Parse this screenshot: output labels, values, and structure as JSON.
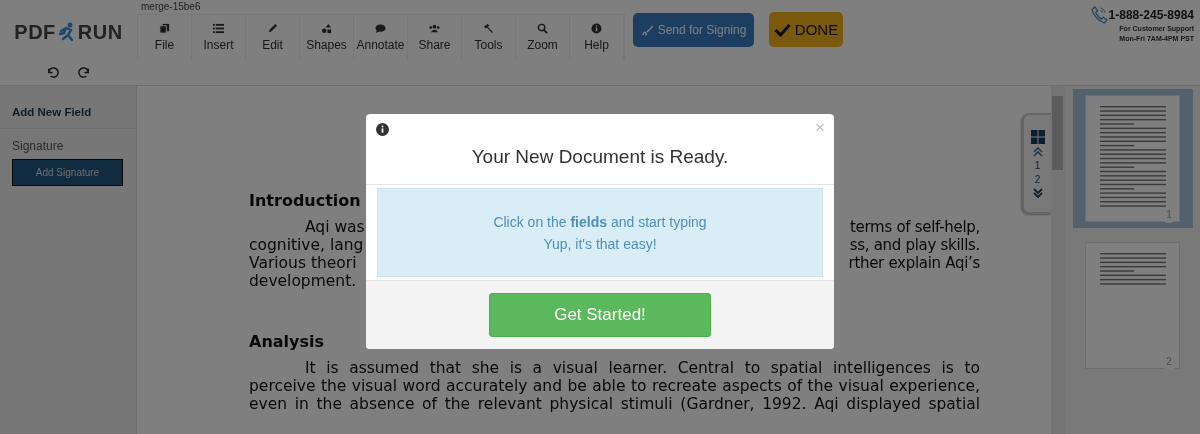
{
  "logo": {
    "left": "PDF",
    "right": "RUN"
  },
  "file_name": "merge-15be6",
  "menu": [
    {
      "kind": "file",
      "label": "File"
    },
    {
      "kind": "insert",
      "label": "Insert"
    },
    {
      "kind": "edit",
      "label": "Edit"
    },
    {
      "kind": "shapes",
      "label": "Shapes"
    },
    {
      "kind": "annotate",
      "label": "Annotate"
    },
    {
      "kind": "share",
      "label": "Share"
    },
    {
      "kind": "tools",
      "label": "Tools"
    },
    {
      "kind": "zoom",
      "label": "Zoom"
    },
    {
      "kind": "help",
      "label": "Help"
    }
  ],
  "send_button": "Send for Signing",
  "done_button": "DONE",
  "support": {
    "phone": "1-888-245-8984",
    "line1": "For Customer Support",
    "line2": "Mon-Fri 7AM-4PM PST"
  },
  "sidebar": {
    "title": "Add New Field",
    "section": "Signature",
    "button": "Add Signature"
  },
  "document": {
    "sections": [
      {
        "heading": "Introduction",
        "lines": [
          {
            "left": "Aqi was",
            "right": "terms of self-help,",
            "indent": true
          },
          {
            "left": "cognitive, lang",
            "right": "ss, and play skills.",
            "indent": false
          },
          {
            "left": "Various theori",
            "right": "rther explain Aqi’s",
            "indent": false
          },
          {
            "left": "development.",
            "indent": false
          }
        ]
      },
      {
        "heading": "Analysis",
        "lines": [
          {
            "left": "It is assumed that she is a visual learner.  Central to spatial intelligences is to",
            "indent": true
          },
          {
            "left": "perceive the visual word accurately and be able to recreate aspects of the visual experience,",
            "indent": false
          },
          {
            "left": "even in the absence of the relevant physical stimuli (Gardner, 1992. Aqi displayed spatial",
            "indent": false
          }
        ]
      }
    ]
  },
  "page_nav": {
    "pages": [
      "1",
      "2"
    ]
  },
  "thumbnails": [
    {
      "label": "1",
      "selected": true
    },
    {
      "label": "2",
      "selected": false
    }
  ],
  "modal": {
    "title": "Your New Document is Ready.",
    "close": "×",
    "message": "Click on the **fields** and start typing",
    "message2": "Yup, it's that easy!",
    "button": "Get Started!"
  }
}
